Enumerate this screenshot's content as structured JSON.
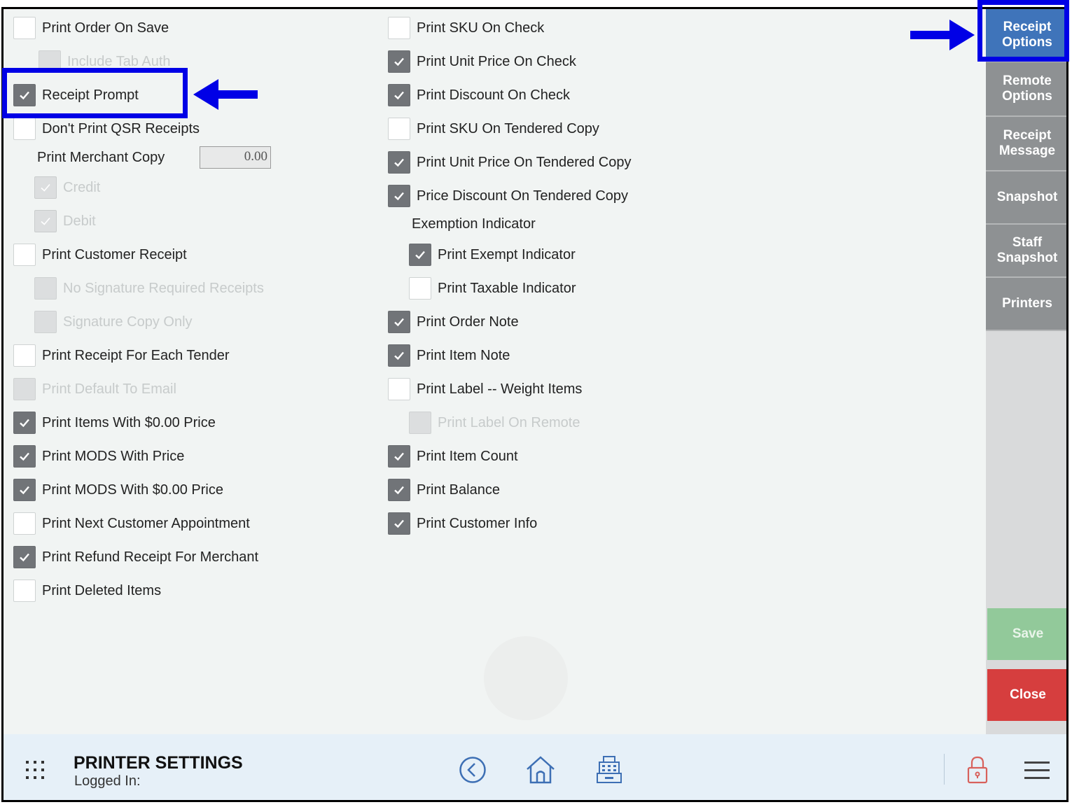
{
  "left_column": {
    "print_order_on_save": {
      "label": "Print Order On Save",
      "checked": false
    },
    "include_tab_auth": {
      "label": "Include Tab Auth",
      "checked": false,
      "disabled": true
    },
    "receipt_prompt": {
      "label": "Receipt Prompt",
      "checked": true
    },
    "dont_print_qsr": {
      "label": "Don't Print QSR Receipts",
      "checked": false
    },
    "print_merchant_copy": {
      "label": "Print Merchant Copy",
      "value": "0.00"
    },
    "credit": {
      "label": "Credit",
      "checked": true,
      "disabled": true
    },
    "debit": {
      "label": "Debit",
      "checked": true,
      "disabled": true
    },
    "print_customer_receipt": {
      "label": "Print Customer Receipt",
      "checked": false
    },
    "no_signature": {
      "label": "No Signature Required Receipts",
      "checked": false,
      "disabled": true
    },
    "signature_copy_only": {
      "label": "Signature Copy Only",
      "checked": false,
      "disabled": true
    },
    "print_receipt_each_tender": {
      "label": "Print Receipt For Each Tender",
      "checked": false
    },
    "print_default_email": {
      "label": "Print Default To Email",
      "checked": false,
      "disabled": true
    },
    "print_items_zero": {
      "label": "Print Items With $0.00 Price",
      "checked": true
    },
    "print_mods_price": {
      "label": "Print MODS With Price",
      "checked": true
    },
    "print_mods_zero": {
      "label": "Print MODS With $0.00 Price",
      "checked": true
    },
    "print_next_appt": {
      "label": "Print Next Customer Appointment",
      "checked": false
    },
    "print_refund_merchant": {
      "label": "Print Refund Receipt For Merchant",
      "checked": true
    },
    "print_deleted_items": {
      "label": "Print Deleted Items",
      "checked": false
    }
  },
  "right_column": {
    "sku_on_check": {
      "label": "Print SKU On Check",
      "checked": false
    },
    "unit_price_check": {
      "label": "Print Unit Price On Check",
      "checked": true
    },
    "discount_check": {
      "label": "Print Discount On Check",
      "checked": true
    },
    "sku_tendered": {
      "label": "Print SKU On Tendered Copy",
      "checked": false
    },
    "unit_price_tendered": {
      "label": "Print Unit Price On Tendered Copy",
      "checked": true
    },
    "discount_tendered": {
      "label": "Price Discount On Tendered Copy",
      "checked": true
    },
    "exemption_indicator": {
      "label": "Exemption Indicator"
    },
    "exempt_indicator": {
      "label": "Print Exempt Indicator",
      "checked": true
    },
    "taxable_indicator": {
      "label": "Print Taxable Indicator",
      "checked": false
    },
    "order_note": {
      "label": "Print Order Note",
      "checked": true
    },
    "item_note": {
      "label": "Print Item Note",
      "checked": true
    },
    "label_weight": {
      "label": "Print Label -- Weight Items",
      "checked": false
    },
    "label_remote": {
      "label": "Print Label On Remote",
      "checked": false,
      "disabled": true
    },
    "item_count": {
      "label": "Print Item Count",
      "checked": true
    },
    "balance": {
      "label": "Print Balance",
      "checked": true
    },
    "customer_info": {
      "label": "Print Customer Info",
      "checked": true
    }
  },
  "sidebar": {
    "receipt_options": "Receipt Options",
    "remote_options": "Remote Options",
    "receipt_message": "Receipt Message",
    "snapshot": "Snapshot",
    "staff_snapshot": "Staff Snapshot",
    "printers": "Printers",
    "save": "Save",
    "close": "Close"
  },
  "footer": {
    "title": "PRINTER SETTINGS",
    "logged_in": "Logged In:"
  },
  "colors": {
    "highlight": "#0000e6",
    "active_tab": "#3f74ba",
    "tab": "#8e9193",
    "save": "#92c99a",
    "close": "#d63e3e",
    "checked": "#717478"
  }
}
